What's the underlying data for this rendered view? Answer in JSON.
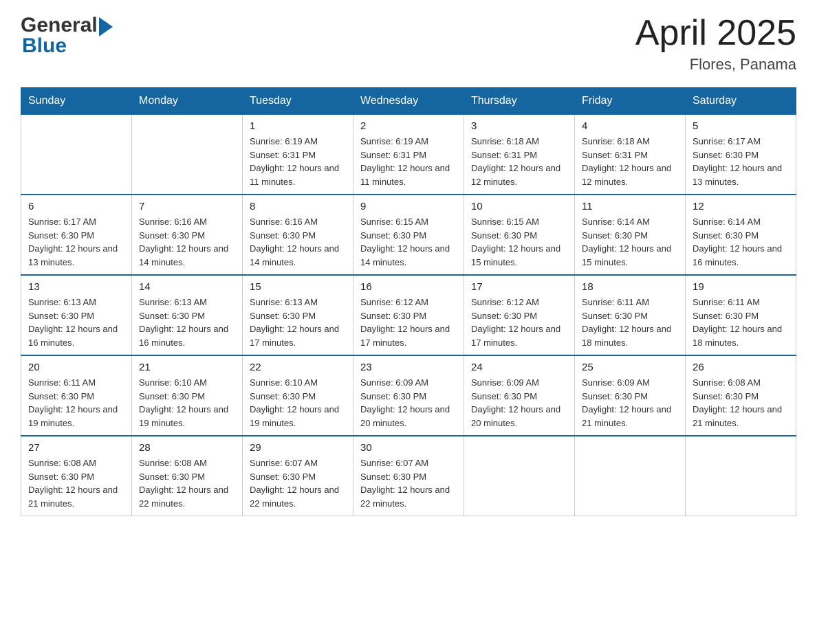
{
  "header": {
    "title": "April 2025",
    "location": "Flores, Panama",
    "logo_general": "General",
    "logo_blue": "Blue"
  },
  "days_of_week": [
    "Sunday",
    "Monday",
    "Tuesday",
    "Wednesday",
    "Thursday",
    "Friday",
    "Saturday"
  ],
  "weeks": [
    [
      {
        "day": "",
        "sunrise": "",
        "sunset": "",
        "daylight": ""
      },
      {
        "day": "",
        "sunrise": "",
        "sunset": "",
        "daylight": ""
      },
      {
        "day": "1",
        "sunrise": "Sunrise: 6:19 AM",
        "sunset": "Sunset: 6:31 PM",
        "daylight": "Daylight: 12 hours and 11 minutes."
      },
      {
        "day": "2",
        "sunrise": "Sunrise: 6:19 AM",
        "sunset": "Sunset: 6:31 PM",
        "daylight": "Daylight: 12 hours and 11 minutes."
      },
      {
        "day": "3",
        "sunrise": "Sunrise: 6:18 AM",
        "sunset": "Sunset: 6:31 PM",
        "daylight": "Daylight: 12 hours and 12 minutes."
      },
      {
        "day": "4",
        "sunrise": "Sunrise: 6:18 AM",
        "sunset": "Sunset: 6:31 PM",
        "daylight": "Daylight: 12 hours and 12 minutes."
      },
      {
        "day": "5",
        "sunrise": "Sunrise: 6:17 AM",
        "sunset": "Sunset: 6:30 PM",
        "daylight": "Daylight: 12 hours and 13 minutes."
      }
    ],
    [
      {
        "day": "6",
        "sunrise": "Sunrise: 6:17 AM",
        "sunset": "Sunset: 6:30 PM",
        "daylight": "Daylight: 12 hours and 13 minutes."
      },
      {
        "day": "7",
        "sunrise": "Sunrise: 6:16 AM",
        "sunset": "Sunset: 6:30 PM",
        "daylight": "Daylight: 12 hours and 14 minutes."
      },
      {
        "day": "8",
        "sunrise": "Sunrise: 6:16 AM",
        "sunset": "Sunset: 6:30 PM",
        "daylight": "Daylight: 12 hours and 14 minutes."
      },
      {
        "day": "9",
        "sunrise": "Sunrise: 6:15 AM",
        "sunset": "Sunset: 6:30 PM",
        "daylight": "Daylight: 12 hours and 14 minutes."
      },
      {
        "day": "10",
        "sunrise": "Sunrise: 6:15 AM",
        "sunset": "Sunset: 6:30 PM",
        "daylight": "Daylight: 12 hours and 15 minutes."
      },
      {
        "day": "11",
        "sunrise": "Sunrise: 6:14 AM",
        "sunset": "Sunset: 6:30 PM",
        "daylight": "Daylight: 12 hours and 15 minutes."
      },
      {
        "day": "12",
        "sunrise": "Sunrise: 6:14 AM",
        "sunset": "Sunset: 6:30 PM",
        "daylight": "Daylight: 12 hours and 16 minutes."
      }
    ],
    [
      {
        "day": "13",
        "sunrise": "Sunrise: 6:13 AM",
        "sunset": "Sunset: 6:30 PM",
        "daylight": "Daylight: 12 hours and 16 minutes."
      },
      {
        "day": "14",
        "sunrise": "Sunrise: 6:13 AM",
        "sunset": "Sunset: 6:30 PM",
        "daylight": "Daylight: 12 hours and 16 minutes."
      },
      {
        "day": "15",
        "sunrise": "Sunrise: 6:13 AM",
        "sunset": "Sunset: 6:30 PM",
        "daylight": "Daylight: 12 hours and 17 minutes."
      },
      {
        "day": "16",
        "sunrise": "Sunrise: 6:12 AM",
        "sunset": "Sunset: 6:30 PM",
        "daylight": "Daylight: 12 hours and 17 minutes."
      },
      {
        "day": "17",
        "sunrise": "Sunrise: 6:12 AM",
        "sunset": "Sunset: 6:30 PM",
        "daylight": "Daylight: 12 hours and 17 minutes."
      },
      {
        "day": "18",
        "sunrise": "Sunrise: 6:11 AM",
        "sunset": "Sunset: 6:30 PM",
        "daylight": "Daylight: 12 hours and 18 minutes."
      },
      {
        "day": "19",
        "sunrise": "Sunrise: 6:11 AM",
        "sunset": "Sunset: 6:30 PM",
        "daylight": "Daylight: 12 hours and 18 minutes."
      }
    ],
    [
      {
        "day": "20",
        "sunrise": "Sunrise: 6:11 AM",
        "sunset": "Sunset: 6:30 PM",
        "daylight": "Daylight: 12 hours and 19 minutes."
      },
      {
        "day": "21",
        "sunrise": "Sunrise: 6:10 AM",
        "sunset": "Sunset: 6:30 PM",
        "daylight": "Daylight: 12 hours and 19 minutes."
      },
      {
        "day": "22",
        "sunrise": "Sunrise: 6:10 AM",
        "sunset": "Sunset: 6:30 PM",
        "daylight": "Daylight: 12 hours and 19 minutes."
      },
      {
        "day": "23",
        "sunrise": "Sunrise: 6:09 AM",
        "sunset": "Sunset: 6:30 PM",
        "daylight": "Daylight: 12 hours and 20 minutes."
      },
      {
        "day": "24",
        "sunrise": "Sunrise: 6:09 AM",
        "sunset": "Sunset: 6:30 PM",
        "daylight": "Daylight: 12 hours and 20 minutes."
      },
      {
        "day": "25",
        "sunrise": "Sunrise: 6:09 AM",
        "sunset": "Sunset: 6:30 PM",
        "daylight": "Daylight: 12 hours and 21 minutes."
      },
      {
        "day": "26",
        "sunrise": "Sunrise: 6:08 AM",
        "sunset": "Sunset: 6:30 PM",
        "daylight": "Daylight: 12 hours and 21 minutes."
      }
    ],
    [
      {
        "day": "27",
        "sunrise": "Sunrise: 6:08 AM",
        "sunset": "Sunset: 6:30 PM",
        "daylight": "Daylight: 12 hours and 21 minutes."
      },
      {
        "day": "28",
        "sunrise": "Sunrise: 6:08 AM",
        "sunset": "Sunset: 6:30 PM",
        "daylight": "Daylight: 12 hours and 22 minutes."
      },
      {
        "day": "29",
        "sunrise": "Sunrise: 6:07 AM",
        "sunset": "Sunset: 6:30 PM",
        "daylight": "Daylight: 12 hours and 22 minutes."
      },
      {
        "day": "30",
        "sunrise": "Sunrise: 6:07 AM",
        "sunset": "Sunset: 6:30 PM",
        "daylight": "Daylight: 12 hours and 22 minutes."
      },
      {
        "day": "",
        "sunrise": "",
        "sunset": "",
        "daylight": ""
      },
      {
        "day": "",
        "sunrise": "",
        "sunset": "",
        "daylight": ""
      },
      {
        "day": "",
        "sunrise": "",
        "sunset": "",
        "daylight": ""
      }
    ]
  ]
}
